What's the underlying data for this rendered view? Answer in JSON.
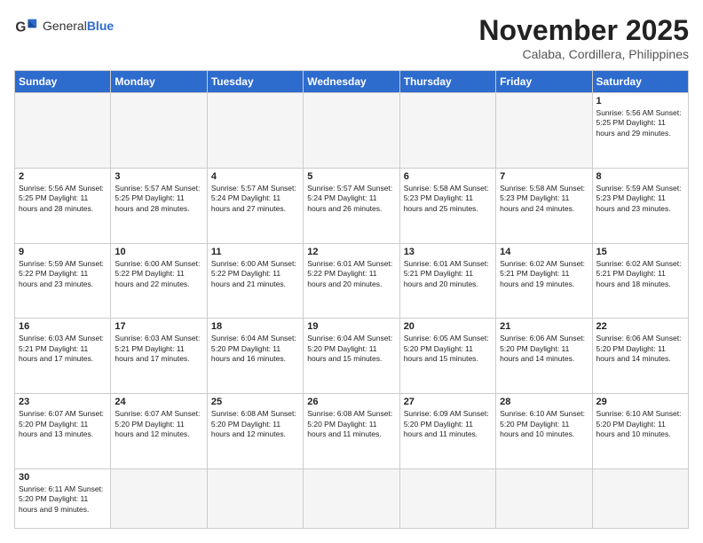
{
  "logo": {
    "text_general": "General",
    "text_blue": "Blue"
  },
  "header": {
    "month": "November 2025",
    "location": "Calaba, Cordillera, Philippines"
  },
  "weekdays": [
    "Sunday",
    "Monday",
    "Tuesday",
    "Wednesday",
    "Thursday",
    "Friday",
    "Saturday"
  ],
  "weeks": [
    [
      {
        "day": "",
        "info": ""
      },
      {
        "day": "",
        "info": ""
      },
      {
        "day": "",
        "info": ""
      },
      {
        "day": "",
        "info": ""
      },
      {
        "day": "",
        "info": ""
      },
      {
        "day": "",
        "info": ""
      },
      {
        "day": "1",
        "info": "Sunrise: 5:56 AM\nSunset: 5:25 PM\nDaylight: 11 hours\nand 29 minutes."
      }
    ],
    [
      {
        "day": "2",
        "info": "Sunrise: 5:56 AM\nSunset: 5:25 PM\nDaylight: 11 hours\nand 28 minutes."
      },
      {
        "day": "3",
        "info": "Sunrise: 5:57 AM\nSunset: 5:25 PM\nDaylight: 11 hours\nand 28 minutes."
      },
      {
        "day": "4",
        "info": "Sunrise: 5:57 AM\nSunset: 5:24 PM\nDaylight: 11 hours\nand 27 minutes."
      },
      {
        "day": "5",
        "info": "Sunrise: 5:57 AM\nSunset: 5:24 PM\nDaylight: 11 hours\nand 26 minutes."
      },
      {
        "day": "6",
        "info": "Sunrise: 5:58 AM\nSunset: 5:23 PM\nDaylight: 11 hours\nand 25 minutes."
      },
      {
        "day": "7",
        "info": "Sunrise: 5:58 AM\nSunset: 5:23 PM\nDaylight: 11 hours\nand 24 minutes."
      },
      {
        "day": "8",
        "info": "Sunrise: 5:59 AM\nSunset: 5:23 PM\nDaylight: 11 hours\nand 23 minutes."
      }
    ],
    [
      {
        "day": "9",
        "info": "Sunrise: 5:59 AM\nSunset: 5:22 PM\nDaylight: 11 hours\nand 23 minutes."
      },
      {
        "day": "10",
        "info": "Sunrise: 6:00 AM\nSunset: 5:22 PM\nDaylight: 11 hours\nand 22 minutes."
      },
      {
        "day": "11",
        "info": "Sunrise: 6:00 AM\nSunset: 5:22 PM\nDaylight: 11 hours\nand 21 minutes."
      },
      {
        "day": "12",
        "info": "Sunrise: 6:01 AM\nSunset: 5:22 PM\nDaylight: 11 hours\nand 20 minutes."
      },
      {
        "day": "13",
        "info": "Sunrise: 6:01 AM\nSunset: 5:21 PM\nDaylight: 11 hours\nand 20 minutes."
      },
      {
        "day": "14",
        "info": "Sunrise: 6:02 AM\nSunset: 5:21 PM\nDaylight: 11 hours\nand 19 minutes."
      },
      {
        "day": "15",
        "info": "Sunrise: 6:02 AM\nSunset: 5:21 PM\nDaylight: 11 hours\nand 18 minutes."
      }
    ],
    [
      {
        "day": "16",
        "info": "Sunrise: 6:03 AM\nSunset: 5:21 PM\nDaylight: 11 hours\nand 17 minutes."
      },
      {
        "day": "17",
        "info": "Sunrise: 6:03 AM\nSunset: 5:21 PM\nDaylight: 11 hours\nand 17 minutes."
      },
      {
        "day": "18",
        "info": "Sunrise: 6:04 AM\nSunset: 5:20 PM\nDaylight: 11 hours\nand 16 minutes."
      },
      {
        "day": "19",
        "info": "Sunrise: 6:04 AM\nSunset: 5:20 PM\nDaylight: 11 hours\nand 15 minutes."
      },
      {
        "day": "20",
        "info": "Sunrise: 6:05 AM\nSunset: 5:20 PM\nDaylight: 11 hours\nand 15 minutes."
      },
      {
        "day": "21",
        "info": "Sunrise: 6:06 AM\nSunset: 5:20 PM\nDaylight: 11 hours\nand 14 minutes."
      },
      {
        "day": "22",
        "info": "Sunrise: 6:06 AM\nSunset: 5:20 PM\nDaylight: 11 hours\nand 14 minutes."
      }
    ],
    [
      {
        "day": "23",
        "info": "Sunrise: 6:07 AM\nSunset: 5:20 PM\nDaylight: 11 hours\nand 13 minutes."
      },
      {
        "day": "24",
        "info": "Sunrise: 6:07 AM\nSunset: 5:20 PM\nDaylight: 11 hours\nand 12 minutes."
      },
      {
        "day": "25",
        "info": "Sunrise: 6:08 AM\nSunset: 5:20 PM\nDaylight: 11 hours\nand 12 minutes."
      },
      {
        "day": "26",
        "info": "Sunrise: 6:08 AM\nSunset: 5:20 PM\nDaylight: 11 hours\nand 11 minutes."
      },
      {
        "day": "27",
        "info": "Sunrise: 6:09 AM\nSunset: 5:20 PM\nDaylight: 11 hours\nand 11 minutes."
      },
      {
        "day": "28",
        "info": "Sunrise: 6:10 AM\nSunset: 5:20 PM\nDaylight: 11 hours\nand 10 minutes."
      },
      {
        "day": "29",
        "info": "Sunrise: 6:10 AM\nSunset: 5:20 PM\nDaylight: 11 hours\nand 10 minutes."
      }
    ],
    [
      {
        "day": "30",
        "info": "Sunrise: 6:11 AM\nSunset: 5:20 PM\nDaylight: 11 hours\nand 9 minutes."
      },
      {
        "day": "",
        "info": ""
      },
      {
        "day": "",
        "info": ""
      },
      {
        "day": "",
        "info": ""
      },
      {
        "day": "",
        "info": ""
      },
      {
        "day": "",
        "info": ""
      },
      {
        "day": "",
        "info": ""
      }
    ]
  ]
}
